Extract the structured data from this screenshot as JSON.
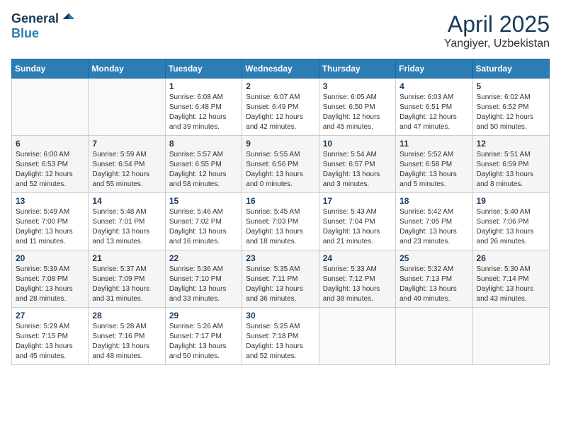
{
  "header": {
    "logo_general": "General",
    "logo_blue": "Blue",
    "month_year": "April 2025",
    "location": "Yangiyer, Uzbekistan"
  },
  "weekdays": [
    "Sunday",
    "Monday",
    "Tuesday",
    "Wednesday",
    "Thursday",
    "Friday",
    "Saturday"
  ],
  "weeks": [
    [
      {
        "day": "",
        "content": ""
      },
      {
        "day": "",
        "content": ""
      },
      {
        "day": "1",
        "content": "Sunrise: 6:08 AM\nSunset: 6:48 PM\nDaylight: 12 hours and 39 minutes."
      },
      {
        "day": "2",
        "content": "Sunrise: 6:07 AM\nSunset: 6:49 PM\nDaylight: 12 hours and 42 minutes."
      },
      {
        "day": "3",
        "content": "Sunrise: 6:05 AM\nSunset: 6:50 PM\nDaylight: 12 hours and 45 minutes."
      },
      {
        "day": "4",
        "content": "Sunrise: 6:03 AM\nSunset: 6:51 PM\nDaylight: 12 hours and 47 minutes."
      },
      {
        "day": "5",
        "content": "Sunrise: 6:02 AM\nSunset: 6:52 PM\nDaylight: 12 hours and 50 minutes."
      }
    ],
    [
      {
        "day": "6",
        "content": "Sunrise: 6:00 AM\nSunset: 6:53 PM\nDaylight: 12 hours and 52 minutes."
      },
      {
        "day": "7",
        "content": "Sunrise: 5:59 AM\nSunset: 6:54 PM\nDaylight: 12 hours and 55 minutes."
      },
      {
        "day": "8",
        "content": "Sunrise: 5:57 AM\nSunset: 6:55 PM\nDaylight: 12 hours and 58 minutes."
      },
      {
        "day": "9",
        "content": "Sunrise: 5:55 AM\nSunset: 6:56 PM\nDaylight: 13 hours and 0 minutes."
      },
      {
        "day": "10",
        "content": "Sunrise: 5:54 AM\nSunset: 6:57 PM\nDaylight: 13 hours and 3 minutes."
      },
      {
        "day": "11",
        "content": "Sunrise: 5:52 AM\nSunset: 6:58 PM\nDaylight: 13 hours and 5 minutes."
      },
      {
        "day": "12",
        "content": "Sunrise: 5:51 AM\nSunset: 6:59 PM\nDaylight: 13 hours and 8 minutes."
      }
    ],
    [
      {
        "day": "13",
        "content": "Sunrise: 5:49 AM\nSunset: 7:00 PM\nDaylight: 13 hours and 11 minutes."
      },
      {
        "day": "14",
        "content": "Sunrise: 5:48 AM\nSunset: 7:01 PM\nDaylight: 13 hours and 13 minutes."
      },
      {
        "day": "15",
        "content": "Sunrise: 5:46 AM\nSunset: 7:02 PM\nDaylight: 13 hours and 16 minutes."
      },
      {
        "day": "16",
        "content": "Sunrise: 5:45 AM\nSunset: 7:03 PM\nDaylight: 13 hours and 18 minutes."
      },
      {
        "day": "17",
        "content": "Sunrise: 5:43 AM\nSunset: 7:04 PM\nDaylight: 13 hours and 21 minutes."
      },
      {
        "day": "18",
        "content": "Sunrise: 5:42 AM\nSunset: 7:05 PM\nDaylight: 13 hours and 23 minutes."
      },
      {
        "day": "19",
        "content": "Sunrise: 5:40 AM\nSunset: 7:06 PM\nDaylight: 13 hours and 26 minutes."
      }
    ],
    [
      {
        "day": "20",
        "content": "Sunrise: 5:39 AM\nSunset: 7:08 PM\nDaylight: 13 hours and 28 minutes."
      },
      {
        "day": "21",
        "content": "Sunrise: 5:37 AM\nSunset: 7:09 PM\nDaylight: 13 hours and 31 minutes."
      },
      {
        "day": "22",
        "content": "Sunrise: 5:36 AM\nSunset: 7:10 PM\nDaylight: 13 hours and 33 minutes."
      },
      {
        "day": "23",
        "content": "Sunrise: 5:35 AM\nSunset: 7:11 PM\nDaylight: 13 hours and 36 minutes."
      },
      {
        "day": "24",
        "content": "Sunrise: 5:33 AM\nSunset: 7:12 PM\nDaylight: 13 hours and 38 minutes."
      },
      {
        "day": "25",
        "content": "Sunrise: 5:32 AM\nSunset: 7:13 PM\nDaylight: 13 hours and 40 minutes."
      },
      {
        "day": "26",
        "content": "Sunrise: 5:30 AM\nSunset: 7:14 PM\nDaylight: 13 hours and 43 minutes."
      }
    ],
    [
      {
        "day": "27",
        "content": "Sunrise: 5:29 AM\nSunset: 7:15 PM\nDaylight: 13 hours and 45 minutes."
      },
      {
        "day": "28",
        "content": "Sunrise: 5:28 AM\nSunset: 7:16 PM\nDaylight: 13 hours and 48 minutes."
      },
      {
        "day": "29",
        "content": "Sunrise: 5:26 AM\nSunset: 7:17 PM\nDaylight: 13 hours and 50 minutes."
      },
      {
        "day": "30",
        "content": "Sunrise: 5:25 AM\nSunset: 7:18 PM\nDaylight: 13 hours and 52 minutes."
      },
      {
        "day": "",
        "content": ""
      },
      {
        "day": "",
        "content": ""
      },
      {
        "day": "",
        "content": ""
      }
    ]
  ]
}
